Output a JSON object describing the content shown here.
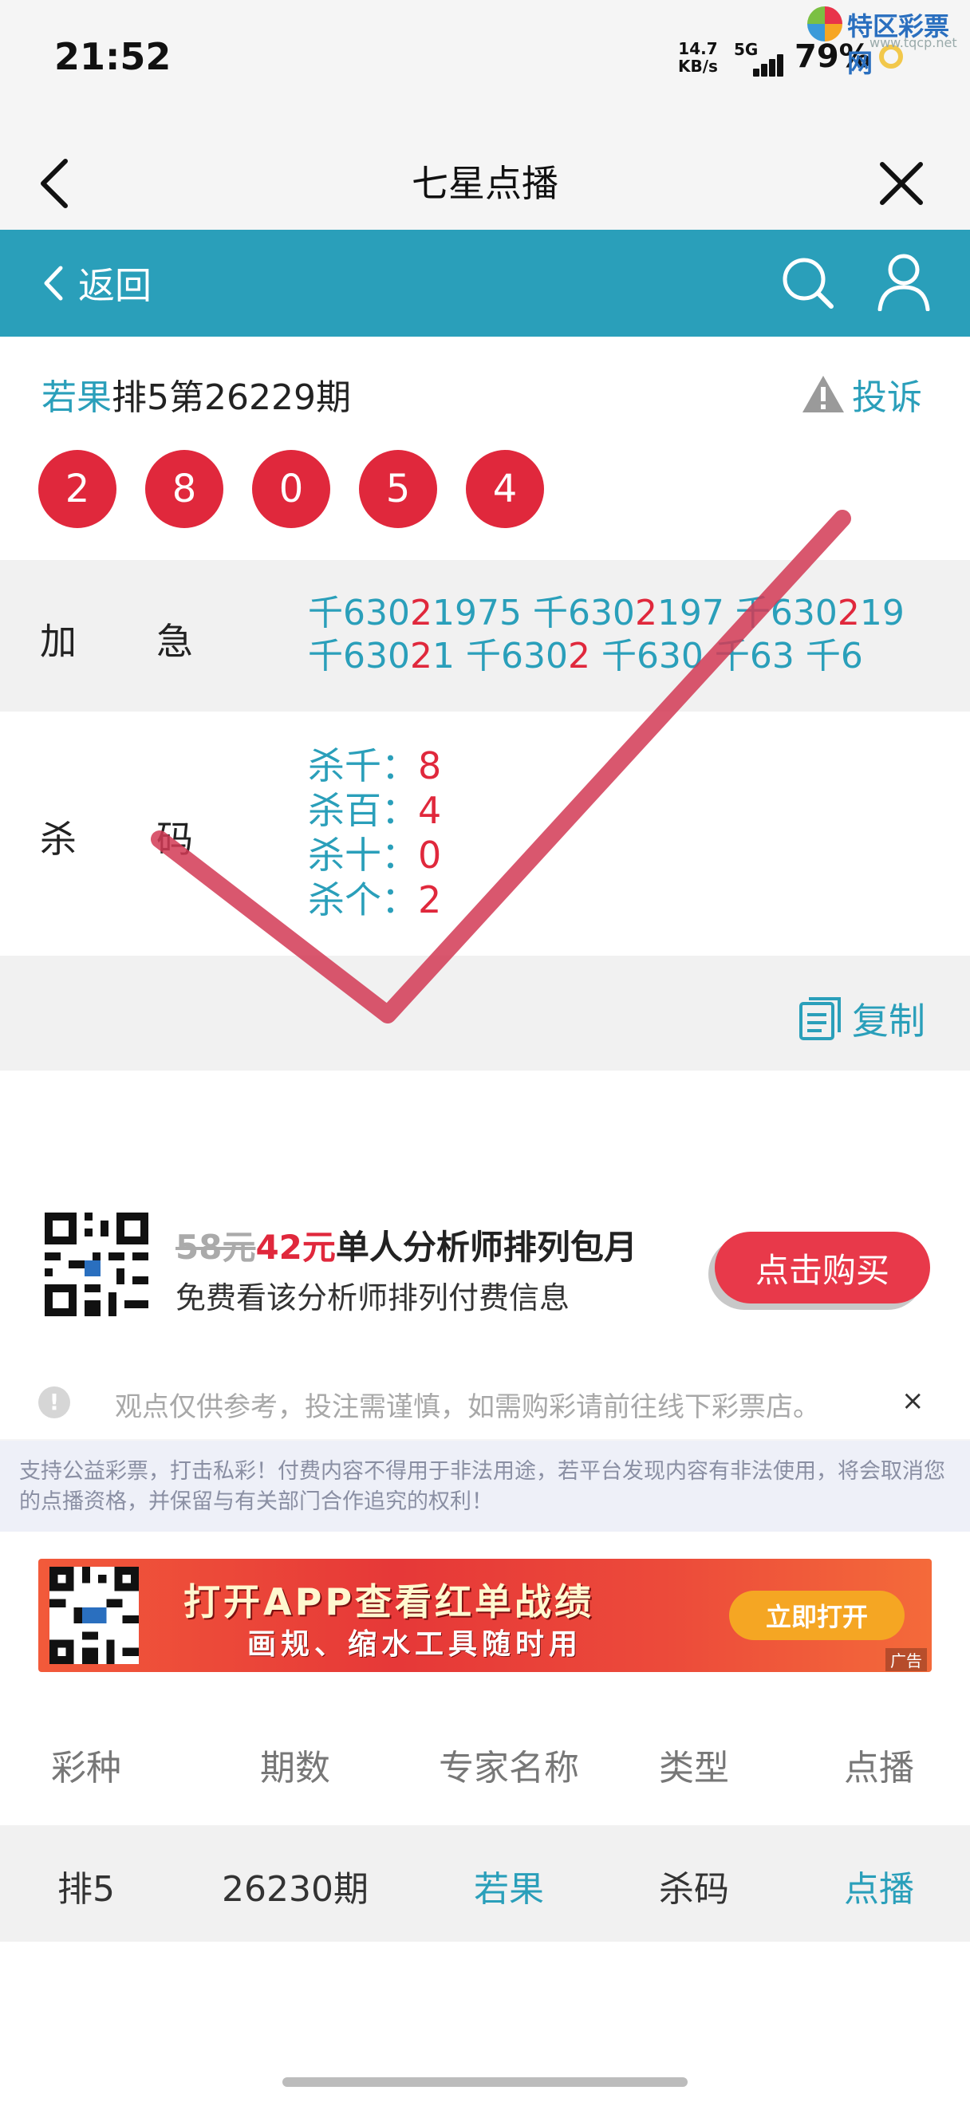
{
  "status_bar": {
    "time": "21:52",
    "net_speed": "14.7",
    "net_unit": "KB/s",
    "net_type": "5G",
    "battery": "79%",
    "watermark_text": "特区彩票网",
    "watermark_url": "www.tqcp.net"
  },
  "nav": {
    "title": "七星点播"
  },
  "toolbar": {
    "back_label": "返回"
  },
  "draw": {
    "brand": "若果",
    "issue_text": "排5第26229期",
    "complain_label": "投诉",
    "balls": [
      "2",
      "8",
      "0",
      "5",
      "4"
    ]
  },
  "rows": {
    "urgent_label_1": "加",
    "urgent_label_2": "急",
    "codes_line1": [
      {
        "t": "千630",
        "red": false
      },
      {
        "t": "2",
        "red": true
      },
      {
        "t": "1975 千630",
        "red": false
      },
      {
        "t": "2",
        "red": true
      },
      {
        "t": "197 千630",
        "red": false
      },
      {
        "t": "2",
        "red": true
      },
      {
        "t": "19",
        "red": false
      }
    ],
    "codes_line2": [
      {
        "t": "千630",
        "red": false
      },
      {
        "t": "2",
        "red": true
      },
      {
        "t": "1 千630",
        "red": false
      },
      {
        "t": "2",
        "red": true
      },
      {
        "t": " 千630 千63 千6",
        "red": false
      }
    ],
    "kill_label_1": "杀",
    "kill_label_2": "码",
    "kill_items": [
      {
        "label": "杀千：",
        "value": "8"
      },
      {
        "label": "杀百：",
        "value": "4"
      },
      {
        "label": "杀十：",
        "value": "0"
      },
      {
        "label": "杀个：",
        "value": "2"
      }
    ],
    "copy_label": "复制"
  },
  "promo": {
    "old_price": "58元",
    "new_price": "42元",
    "title": "单人分析师排列包月",
    "subtitle": "免费看该分析师排列付费信息",
    "buy_label": "点击购买"
  },
  "notice": {
    "icon_text": "!",
    "text": "观点仅供参考，投注需谨慎，如需购彩请前往线下彩票店。",
    "close": "×"
  },
  "disclaimer": "支持公益彩票，打击私彩！付费内容不得用于非法用途，若平台发现内容有非法使用，将会取消您的点播资格，并保留与有关部门合作追究的权利！",
  "banner": {
    "title": "打开APP查看红单战绩",
    "subtitle": "画规、缩水工具随时用",
    "button": "立即打开",
    "ad": "广告"
  },
  "table": {
    "headers": [
      "彩种",
      "期数",
      "专家名称",
      "类型",
      "点播"
    ],
    "rows": [
      [
        "排5",
        "26230期",
        "若果",
        "杀码",
        "点播"
      ]
    ]
  },
  "colors": {
    "accent": "#2a9fba",
    "red": "#e0283c",
    "check": "#d23a55"
  }
}
